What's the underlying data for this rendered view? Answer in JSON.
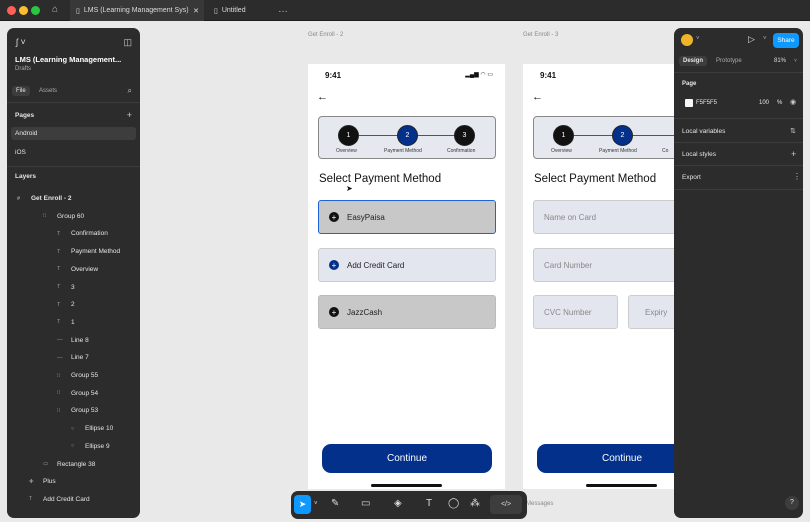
{
  "titlebar": {
    "tab_active": "LMS (Learning Management Sys)",
    "tab_other": "Untitled"
  },
  "left": {
    "file_name": "LMS (Learning Management...",
    "file_sub": "Drafts",
    "tab_file": "File",
    "tab_assets": "Assets",
    "pages_title": "Pages",
    "pages": [
      "Android",
      "iOS"
    ],
    "layers_title": "Layers",
    "layers": [
      "Get Enroll - 2",
      "Group 60",
      "Confirmation",
      "Payment Method",
      "Overview",
      "3",
      "2",
      "1",
      "Line 8",
      "Line 7",
      "Group 55",
      "Group 54",
      "Group 53",
      "Ellipse 10",
      "Ellipse 9",
      "Rectangle 38",
      "Plus",
      "Add Credit Card"
    ]
  },
  "right": {
    "tab_design": "Design",
    "tab_prototype": "Prototype",
    "zoom": "81%",
    "share": "Share",
    "page_title": "Page",
    "color_hex": "F5F5F5",
    "color_opacity": "100",
    "pct": "%",
    "local_variables": "Local variables",
    "local_styles": "Local styles",
    "export": "Export",
    "help": "?"
  },
  "frame1": {
    "label": "Get Enroll - 2",
    "time": "9:41",
    "title": "Select Payment Method",
    "steps": [
      {
        "n": "1",
        "label": "Overview"
      },
      {
        "n": "2",
        "label": "Payment Method"
      },
      {
        "n": "3",
        "label": "Confirmation"
      }
    ],
    "options": [
      "EasyPaisa",
      "Add Credit Card",
      "JazzCash"
    ],
    "continue": "Continue"
  },
  "frame2": {
    "label": "Get Enroll - 3",
    "time": "9:41",
    "title": "Select Payment Method",
    "steps": [
      {
        "n": "1",
        "label": "Overview"
      },
      {
        "n": "2",
        "label": "Payment Method"
      },
      {
        "n": "",
        "label": "Co"
      }
    ],
    "name_placeholder": "Name on Card",
    "number_placeholder": "Card Number",
    "cvc_placeholder": "CVC Number",
    "expiry_placeholder": "Expiry",
    "continue": "Continue"
  },
  "canvas": {
    "messages": "Messages"
  },
  "colors": {
    "primary": "#03308b",
    "panel": "#2c2c2c",
    "accent": "#0d99ff"
  }
}
